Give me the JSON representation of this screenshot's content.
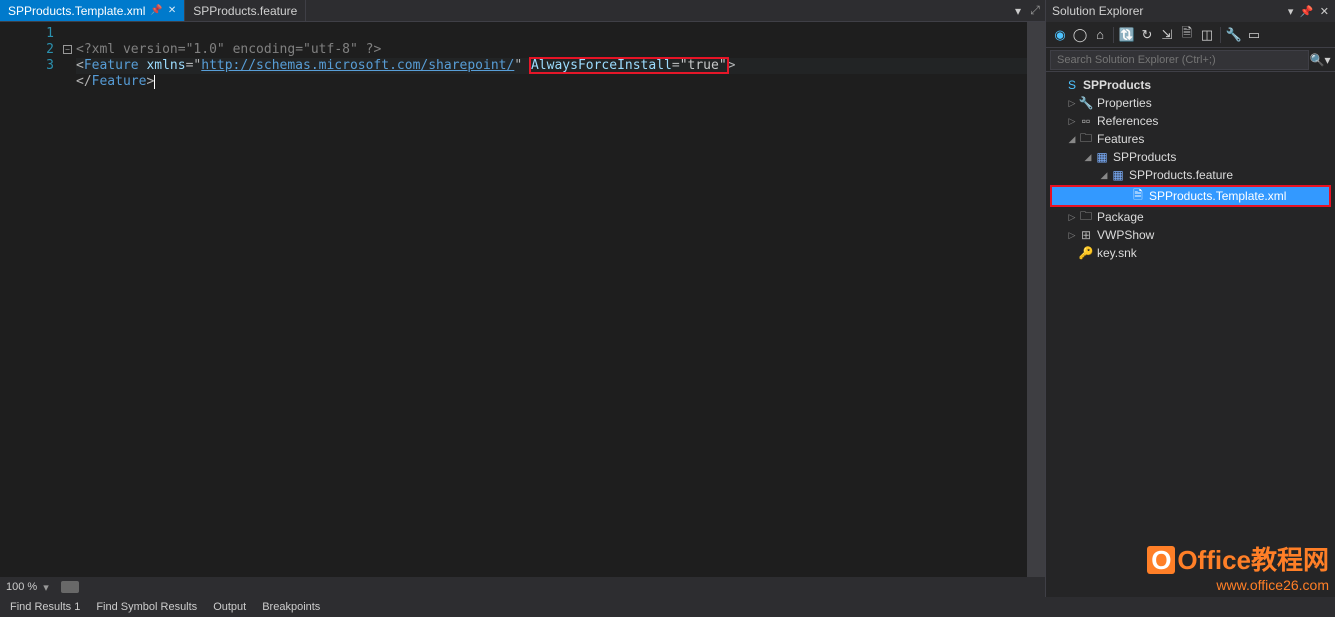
{
  "tabs": [
    {
      "label": "SPProducts.Template.xml",
      "active": true,
      "pinned": true
    },
    {
      "label": "SPProducts.feature",
      "active": false,
      "pinned": false
    }
  ],
  "code": {
    "line1": {
      "pre": "<?",
      "kw": "xml",
      "a1": "version",
      "v1": "\"1.0\"",
      "a2": "encoding",
      "v2": "\"utf-8\"",
      "post": "?>"
    },
    "line2": {
      "open": "<",
      "tag": "Feature",
      "a1": "xmlns",
      "eq": "=",
      "v1q": "\"",
      "v1": "http://schemas.microsoft.com/sharepoint/",
      "v1q2": "\"",
      "a2": "AlwaysForceInstall",
      "v2": "\"true\"",
      "close": ">"
    },
    "line3": {
      "open": "</",
      "tag": "Feature",
      "close": ">"
    }
  },
  "line_numbers": [
    "1",
    "2",
    "3"
  ],
  "zoom": "100 %",
  "bottom_tabs": [
    "Find Results 1",
    "Find Symbol Results",
    "Output",
    "Breakpoints"
  ],
  "solution_explorer": {
    "title": "Solution Explorer",
    "search_placeholder": "Search Solution Explorer (Ctrl+;)",
    "tree": {
      "root": "SPProducts",
      "properties": "Properties",
      "references": "References",
      "features": "Features",
      "spproducts": "SPProducts",
      "feature_file": "SPProducts.feature",
      "template_file": "SPProducts.Template.xml",
      "package": "Package",
      "vwpshow": "VWPShow",
      "keysnk": "key.snk"
    }
  },
  "watermark": {
    "brand": "Office教程网",
    "url": "www.office26.com"
  }
}
